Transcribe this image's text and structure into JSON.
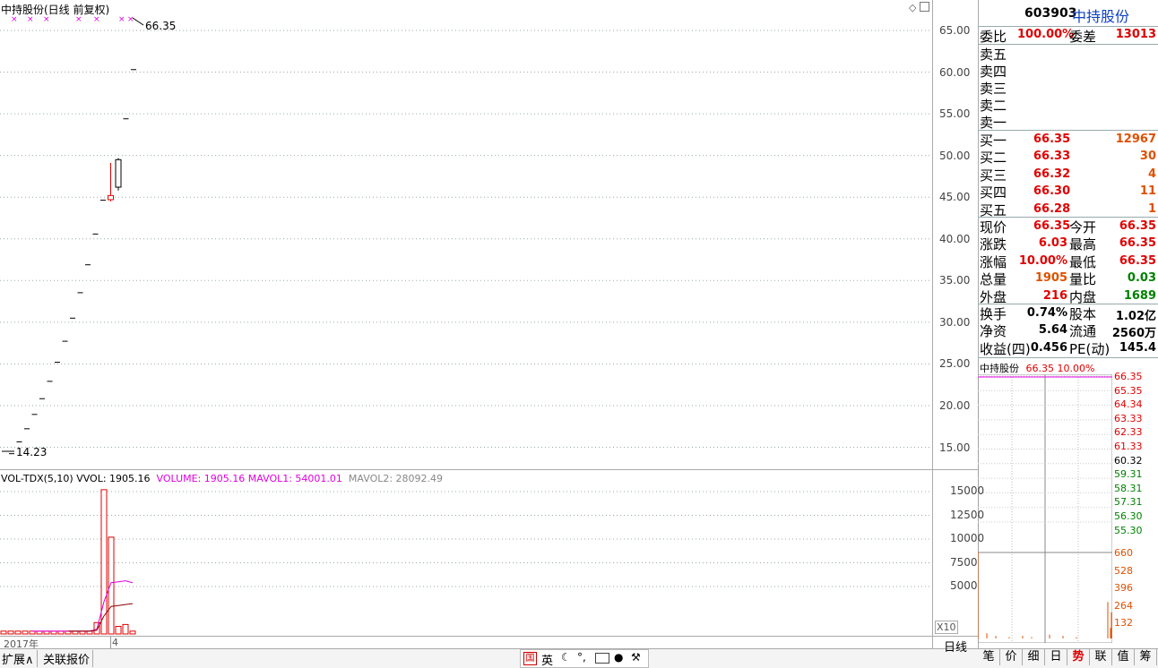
{
  "main_chart": {
    "title": "中持股份(日线 前复权)",
    "price_max_label": "66.35",
    "price_min_label": "14.23",
    "y_ticks": [
      "65.00",
      "60.00",
      "55.00",
      "50.00",
      "45.00",
      "40.00",
      "35.00",
      "30.00",
      "25.00",
      "20.00",
      "15.00"
    ]
  },
  "chart_data": [
    {
      "type": "candlestick",
      "title": "中持股份(日线 前复权)",
      "ylim": [
        12,
        67
      ],
      "annotations": [
        {
          "label": "66.35",
          "type": "max"
        },
        {
          "label": "14.23",
          "type": "min"
        }
      ],
      "candles": [
        {
          "o": 14.23,
          "h": 14.23,
          "l": 14.23,
          "c": 14.23
        },
        {
          "o": 15.65,
          "h": 15.65,
          "l": 15.65,
          "c": 15.65
        },
        {
          "o": 17.22,
          "h": 17.22,
          "l": 17.22,
          "c": 17.22
        },
        {
          "o": 18.94,
          "h": 18.94,
          "l": 18.94,
          "c": 18.94
        },
        {
          "o": 20.83,
          "h": 20.83,
          "l": 20.83,
          "c": 20.83
        },
        {
          "o": 22.91,
          "h": 22.91,
          "l": 22.91,
          "c": 22.91
        },
        {
          "o": 25.2,
          "h": 25.2,
          "l": 25.2,
          "c": 25.2
        },
        {
          "o": 27.72,
          "h": 27.72,
          "l": 27.72,
          "c": 27.72
        },
        {
          "o": 30.49,
          "h": 30.49,
          "l": 30.49,
          "c": 30.49
        },
        {
          "o": 33.54,
          "h": 33.54,
          "l": 33.54,
          "c": 33.54
        },
        {
          "o": 36.89,
          "h": 36.89,
          "l": 36.89,
          "c": 36.89
        },
        {
          "o": 40.58,
          "h": 40.58,
          "l": 40.58,
          "c": 40.58
        },
        {
          "o": 44.64,
          "h": 44.64,
          "l": 44.64,
          "c": 44.64
        },
        {
          "o": 44.7,
          "h": 49.1,
          "l": 44.5,
          "c": 45.2
        },
        {
          "o": 49.5,
          "h": 49.7,
          "l": 45.8,
          "c": 46.2
        },
        {
          "o": 54.4,
          "h": 54.4,
          "l": 54.4,
          "c": 54.4
        },
        {
          "o": 60.3,
          "h": 60.3,
          "l": 60.3,
          "c": 60.3
        }
      ],
      "marker_count": 7
    },
    {
      "type": "bar",
      "title": "VOL-TDX(5,10)",
      "ylim": [
        0,
        17500
      ],
      "values": [
        300,
        300,
        300,
        300,
        300,
        300,
        300,
        300,
        300,
        300,
        300,
        300,
        300,
        1200,
        15200,
        10200,
        800,
        1000,
        300
      ],
      "series": [
        {
          "name": "MAVOL1",
          "values": [
            null,
            null,
            null,
            null,
            300,
            300,
            300,
            300,
            300,
            300,
            300,
            300,
            300,
            500,
            3400,
            5400,
            5500,
            5600,
            5400
          ]
        },
        {
          "name": "MAVOL2",
          "values": [
            null,
            null,
            null,
            null,
            null,
            null,
            null,
            null,
            null,
            300,
            300,
            300,
            300,
            400,
            1900,
            2900,
            3000,
            3100,
            3200
          ]
        }
      ]
    },
    {
      "type": "line",
      "title": "中持股份 66.35 10.00%",
      "ylim": [
        55.3,
        66.35
      ],
      "values": [
        66.35,
        66.35,
        66.35,
        66.35,
        66.35,
        66.35,
        66.35
      ],
      "volume_values": [
        660,
        40,
        20,
        10,
        20,
        10,
        30,
        20,
        10,
        280,
        80,
        200
      ]
    }
  ],
  "volume_panel": {
    "title": "VOL-TDX(5,10)",
    "vvol": "VVOL: 1905.16",
    "volume": "VOLUME: 1905.16",
    "mavol1": "MAVOL1: 54001.01",
    "mavol2": "MAVOL2: 28092.49",
    "y_ticks": [
      "15000",
      "12500",
      "10000",
      "7500",
      "5000"
    ],
    "unit": "X10"
  },
  "x_axis": {
    "year": "2017年",
    "month": "4"
  },
  "quote": {
    "code": "603903",
    "name": "中持股份",
    "weibi_label": "委比",
    "weibi": "100.00%",
    "weicha_label": "委差",
    "weicha": "13013",
    "sells": [
      "卖五",
      "卖四",
      "卖三",
      "卖二",
      "卖一"
    ],
    "buys": [
      {
        "label": "买一",
        "price": "66.35",
        "vol": "12967"
      },
      {
        "label": "买二",
        "price": "66.33",
        "vol": "30"
      },
      {
        "label": "买三",
        "price": "66.32",
        "vol": "4"
      },
      {
        "label": "买四",
        "price": "66.30",
        "vol": "11"
      },
      {
        "label": "买五",
        "price": "66.28",
        "vol": "1"
      }
    ],
    "stats1": [
      {
        "l1": "现价",
        "v1": "66.35",
        "l2": "今开",
        "v2": "66.35"
      },
      {
        "l1": "涨跌",
        "v1": "6.03",
        "l2": "最高",
        "v2": "66.35"
      },
      {
        "l1": "涨幅",
        "v1": "10.00%",
        "l2": "最低",
        "v2": "66.35"
      },
      {
        "l1": "总量",
        "v1": "1905",
        "l2": "量比",
        "v2": "0.03"
      },
      {
        "l1": "外盘",
        "v1": "216",
        "l2": "内盘",
        "v2": "1689"
      }
    ],
    "stats2": [
      {
        "l1": "换手",
        "v1": "0.74%",
        "l2": "股本",
        "v2": "1.02亿"
      },
      {
        "l1": "净资",
        "v1": "5.64",
        "l2": "流通",
        "v2": "2560万"
      },
      {
        "l1": "收益(四)",
        "v1": "0.456",
        "l2": "PE(动)",
        "v2": "145.4"
      }
    ]
  },
  "mini_chart": {
    "name": "中持股份",
    "price": "66.35",
    "pct": "10.00%",
    "price_ticks": [
      "66.35",
      "65.35",
      "64.34",
      "63.33",
      "62.33",
      "61.33",
      "60.32",
      "59.31",
      "58.31",
      "57.31",
      "56.30",
      "55.30"
    ],
    "vol_ticks": [
      "660",
      "528",
      "396",
      "264",
      "132"
    ]
  },
  "bottom": {
    "tabs": [
      "扩展∧",
      "关联报价"
    ],
    "period": "日线",
    "right_tabs": [
      "笔",
      "价",
      "细",
      "日",
      "势",
      "联",
      "值",
      "筹"
    ],
    "ime": [
      "英"
    ]
  },
  "colors": {
    "up": "#e00000",
    "down": "#008000",
    "ma1": "#e000e0",
    "ma2": "#8b0000",
    "grid": "#9aa"
  }
}
